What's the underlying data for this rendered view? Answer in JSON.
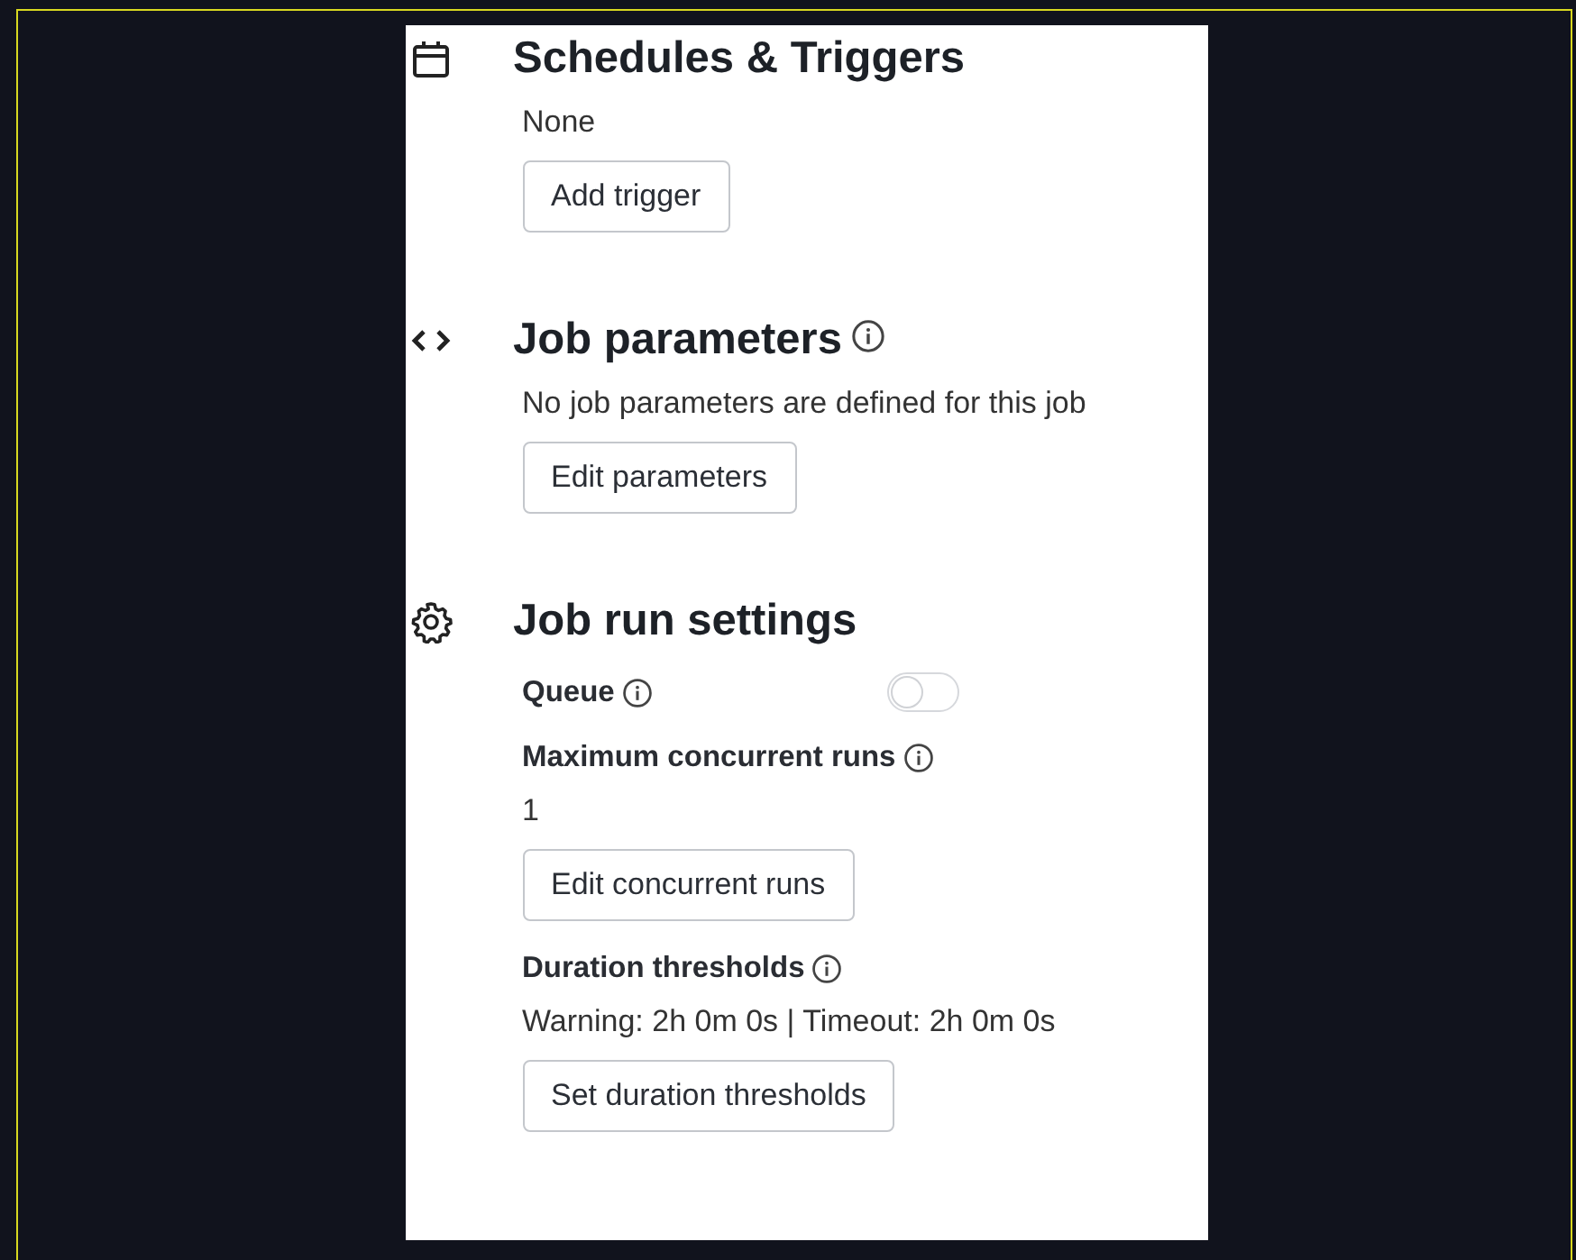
{
  "sections": [
    {
      "title": "Schedules & Triggers",
      "info": false,
      "items": [
        {
          "kind": "text",
          "text": "None"
        },
        {
          "kind": "button",
          "label": "Add trigger"
        }
      ]
    },
    {
      "title": "Job parameters",
      "info": true,
      "items": [
        {
          "kind": "text",
          "text": "No job parameters are defined for this job"
        },
        {
          "kind": "button",
          "label": "Edit parameters"
        }
      ]
    },
    {
      "title": "Job run settings",
      "info": false,
      "items": [
        {
          "kind": "toggle",
          "text": "Queue",
          "info": true,
          "on": false
        },
        {
          "kind": "label",
          "text": "Maximum concurrent runs",
          "info": true
        },
        {
          "kind": "text",
          "text": "1"
        },
        {
          "kind": "button",
          "label": "Edit concurrent runs"
        },
        {
          "kind": "label",
          "text": "Duration thresholds",
          "info": true
        },
        {
          "kind": "text",
          "text": "Warning: 2h 0m 0s | Timeout: 2h 0m 0s"
        },
        {
          "kind": "button",
          "label": "Set duration thresholds"
        }
      ]
    }
  ]
}
